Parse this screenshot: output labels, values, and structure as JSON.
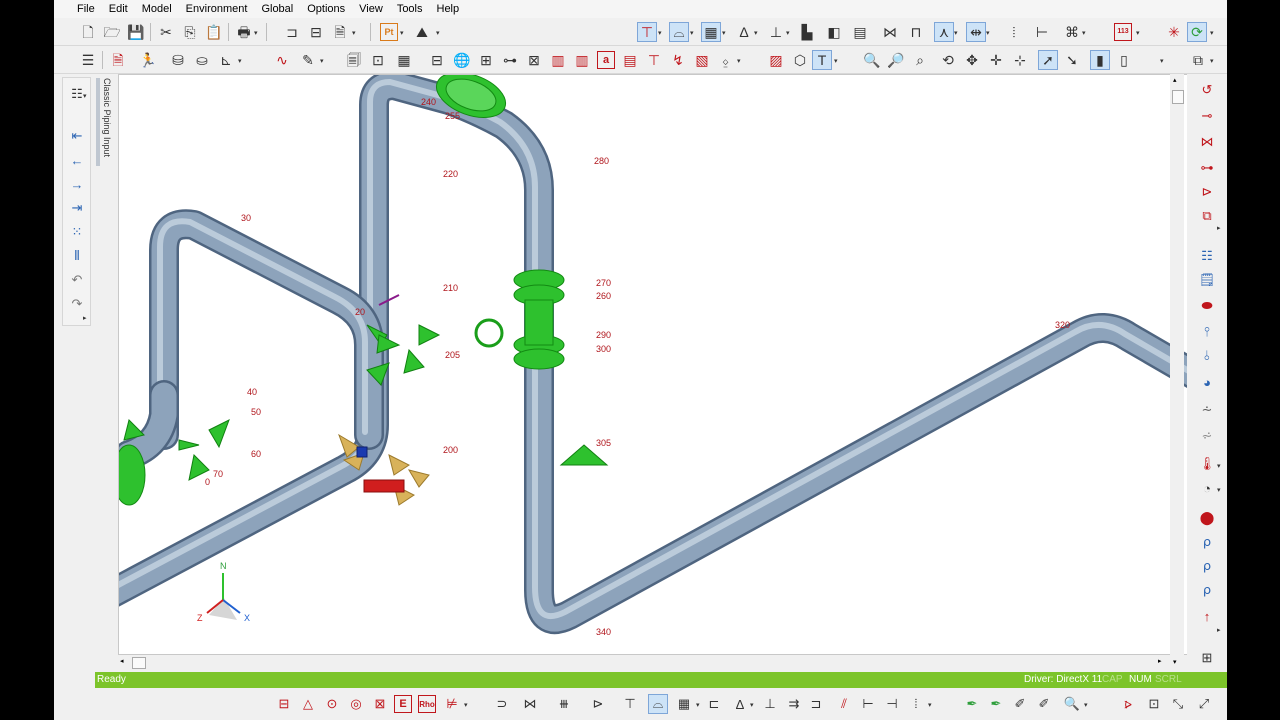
{
  "menu": [
    "File",
    "Edit",
    "Model",
    "Environment",
    "Global",
    "Options",
    "View",
    "Tools",
    "Help"
  ],
  "toolbar": {
    "pt_label": "Pt",
    "tag_113": "113",
    "label_a": "a"
  },
  "side_tab": "Classic Piping Input",
  "node_labels": [
    {
      "text": "240"
    },
    {
      "text": "255"
    },
    {
      "text": "220"
    },
    {
      "text": "280"
    },
    {
      "text": "210"
    },
    {
      "text": "270"
    },
    {
      "text": "260"
    },
    {
      "text": "290"
    },
    {
      "text": "300"
    },
    {
      "text": "30"
    },
    {
      "text": "20"
    },
    {
      "text": "205"
    },
    {
      "text": "40"
    },
    {
      "text": "50"
    },
    {
      "text": "60"
    },
    {
      "text": "70"
    },
    {
      "text": "0"
    },
    {
      "text": "200"
    },
    {
      "text": "305"
    },
    {
      "text": "320"
    },
    {
      "text": "340"
    }
  ],
  "triad": {
    "n": "N",
    "x": "X",
    "z": "Z"
  },
  "status": {
    "ready": "Ready",
    "driver": "Driver: DirectX 11",
    "cap": "CAP",
    "num": "NUM",
    "scrl": "SCRL"
  },
  "bottom_toolbar": {
    "label_e": "E",
    "label_rho": "Rho"
  },
  "colors": {
    "pipe": "#8da3bb",
    "status_bar": "#7cc42a",
    "fitting_green": "#2ec12e",
    "support_gold": "#d8b25a",
    "node_label": "#b0161c"
  }
}
